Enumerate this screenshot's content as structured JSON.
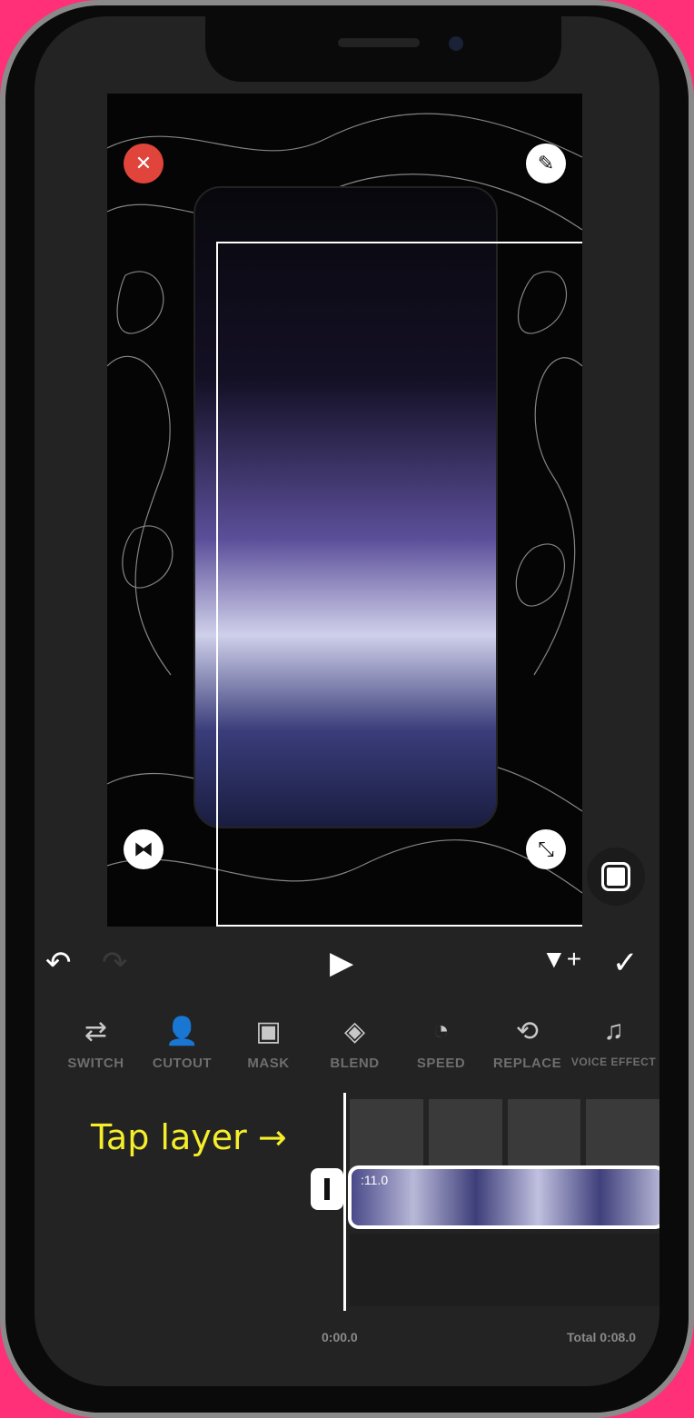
{
  "controls": {
    "undo": "↶",
    "redo": "↷",
    "play": "▶",
    "keyframe": "▼+",
    "confirm": "✓"
  },
  "handles": {
    "delete": "✕",
    "edit": "✎",
    "flip": "⧓",
    "resize": "⤡"
  },
  "tools": [
    {
      "label": "SWITCH",
      "icon": "⇄"
    },
    {
      "label": "CUTOUT",
      "icon": "👤"
    },
    {
      "label": "MASK",
      "icon": "▣"
    },
    {
      "label": "BLEND",
      "icon": "◈"
    },
    {
      "label": "SPEED",
      "icon": "◔"
    },
    {
      "label": "REPLACE",
      "icon": "⟲"
    },
    {
      "label": "VOICE EFFECT",
      "icon": "♫"
    }
  ],
  "timeline": {
    "hint": "Tap layer →",
    "clip_duration": ":11.0",
    "current_time": "0:00.0",
    "total": "Total 0:08.0"
  },
  "colors": {
    "hint": "#f5ee2a",
    "delete": "#e0443a",
    "background": "#232323"
  }
}
